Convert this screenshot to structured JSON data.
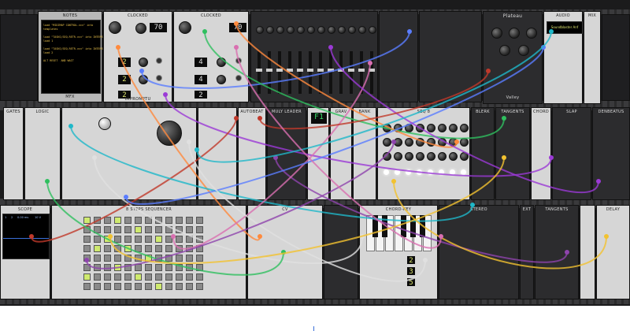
{
  "app": {
    "modules": {
      "notes": {
        "title": "NOTES",
        "lines": [
          "load \"MIDIMAP CONTROL.vcv\" into",
          "templates",
          "",
          "load \"TASKS/SEQ.RETR.vcv\" into INTERFACE",
          "load 1",
          "",
          "load \"TASKS/SEQ.RETR.vcv\" into INTERFACE",
          "load 2",
          "",
          "ALT RESET  AND WAIT"
        ],
        "footer": "MFX"
      },
      "clocked1": {
        "title": "CLOCKED",
        "bpm": "70",
        "ratios": [
          "2",
          "2",
          "2"
        ],
        "footer": "IMPROMPTU"
      },
      "clocked2": {
        "title": "CLOCKED",
        "bpm": "70",
        "ratios": [
          "4",
          "4",
          "2"
        ]
      },
      "plateau": {
        "title": "Plateau",
        "footer": "Valley"
      },
      "audio": {
        "title": "AUDIO",
        "device": "Soundblaster Anf"
      },
      "mix": {
        "title": "MIX"
      },
      "gates": {
        "title": "GATES"
      },
      "logic": {
        "title": "LOGIC"
      },
      "autobeat": {
        "title": "AUTOBEAT"
      },
      "mulyleader": {
        "title": "MULY LEADER"
      },
      "grav": {
        "title": "GRAV"
      },
      "bank": {
        "title": "BANK"
      },
      "seq8": {
        "title": "SEQ 8"
      },
      "blerk": {
        "title": "BLERK"
      },
      "tangents1": {
        "title": "TANGENTS"
      },
      "chord": {
        "title": "CHORD"
      },
      "slap": {
        "title": "SLAP"
      },
      "denbeatus": {
        "title": "DENBEATUS"
      },
      "scope": {
        "title": "SCOPE",
        "readouts": [
          "1",
          "2",
          "0.00 ms",
          "10 V"
        ]
      },
      "sequencer": {
        "title": "8 STEPS SEQUENCER"
      },
      "chordkey": {
        "title": "CHORD-KEY",
        "digits": [
          "2",
          "3",
          "5"
        ]
      },
      "cv": {
        "title": "CV"
      },
      "stereo": {
        "title": "STEREO"
      },
      "ext": {
        "title": "EXT"
      },
      "tangents2": {
        "title": "TANGENTS"
      },
      "delay": {
        "title": "DELAY"
      },
      "f1": {
        "label": "F1"
      }
    }
  },
  "colors": {
    "rack_bg": "#1b1b1c",
    "led_on": "#dfe870",
    "cables": [
      "#ff8a3d",
      "#5a7dff",
      "#9b3ad6",
      "#2fbf5f",
      "#e0e0e0",
      "#c0392b",
      "#8e44ad",
      "#1fb8c9",
      "#d96fb0",
      "#f2c230"
    ]
  }
}
